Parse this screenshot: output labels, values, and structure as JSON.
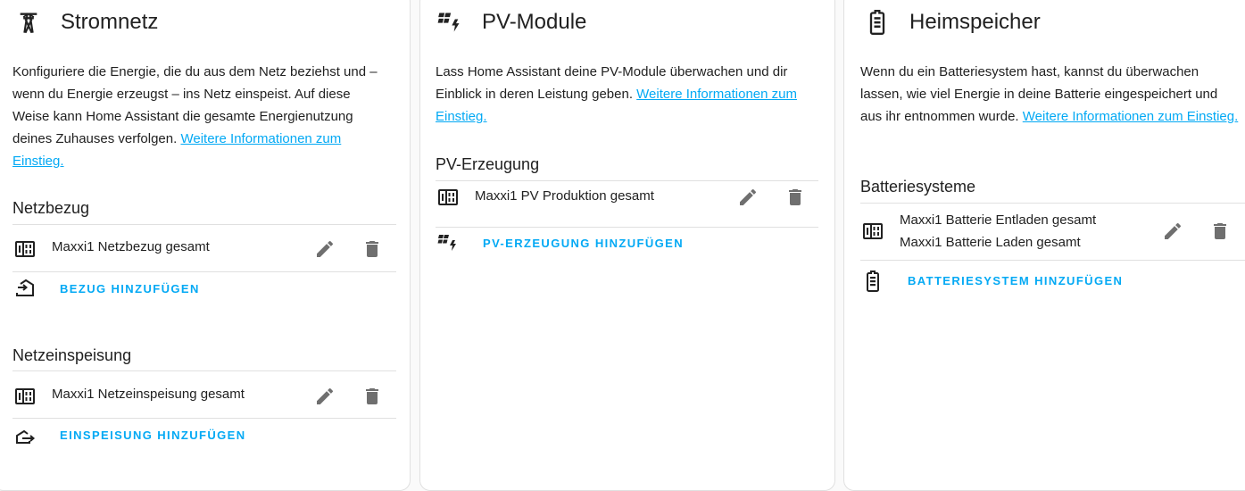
{
  "colors": {
    "accent": "#03a9f4",
    "icon": "#212121",
    "action_icon": "#6f6f6f",
    "divider": "#e0e0e0"
  },
  "grid": {
    "title": "Stromnetz",
    "icon": "transmission-tower-icon",
    "description": "Konfiguriere die Energie, die du aus dem Netz beziehst und – wenn du Energie erzeugst – ins Netz einspeist. Auf diese Weise kann Home Assistant die gesamte Energienutzung deines Zuhauses verfolgen.",
    "link": "Weitere Informationen zum Einstieg.",
    "consumption": {
      "title": "Netzbezug",
      "item": "Maxxi1 Netzbezug gesamt",
      "add_label": "BEZUG HINZUFÜGEN"
    },
    "return": {
      "title": "Netzeinspeisung",
      "item": "Maxxi1 Netzeinspeisung gesamt",
      "add_label": "EINSPEISUNG HINZUFÜGEN"
    }
  },
  "solar": {
    "title": "PV-Module",
    "icon": "solar-power-icon",
    "description": "Lass Home Assistant deine PV-Module überwachen und dir Einblick in deren Leistung geben.",
    "link": "Weitere Informationen zum Einstieg.",
    "section_title": "PV-Erzeugung",
    "item": "Maxxi1 PV Produktion gesamt",
    "add_label": "PV-ERZEUGUNG HINZUFÜGEN"
  },
  "battery": {
    "title": "Heimspeicher",
    "icon": "battery-icon",
    "description": "Wenn du ein Batteriesystem hast, kannst du überwachen lassen, wie viel Energie in deine Batterie eingespeichert und aus ihr entnommen wurde.",
    "link": "Weitere Informationen zum Einstieg.",
    "section_title": "Batteriesysteme",
    "item_line1": "Maxxi1 Batterie Entladen gesamt",
    "item_line2": "Maxxi1 Batterie Laden gesamt",
    "add_label": "BATTERIESYSTEM HINZUFÜGEN"
  }
}
